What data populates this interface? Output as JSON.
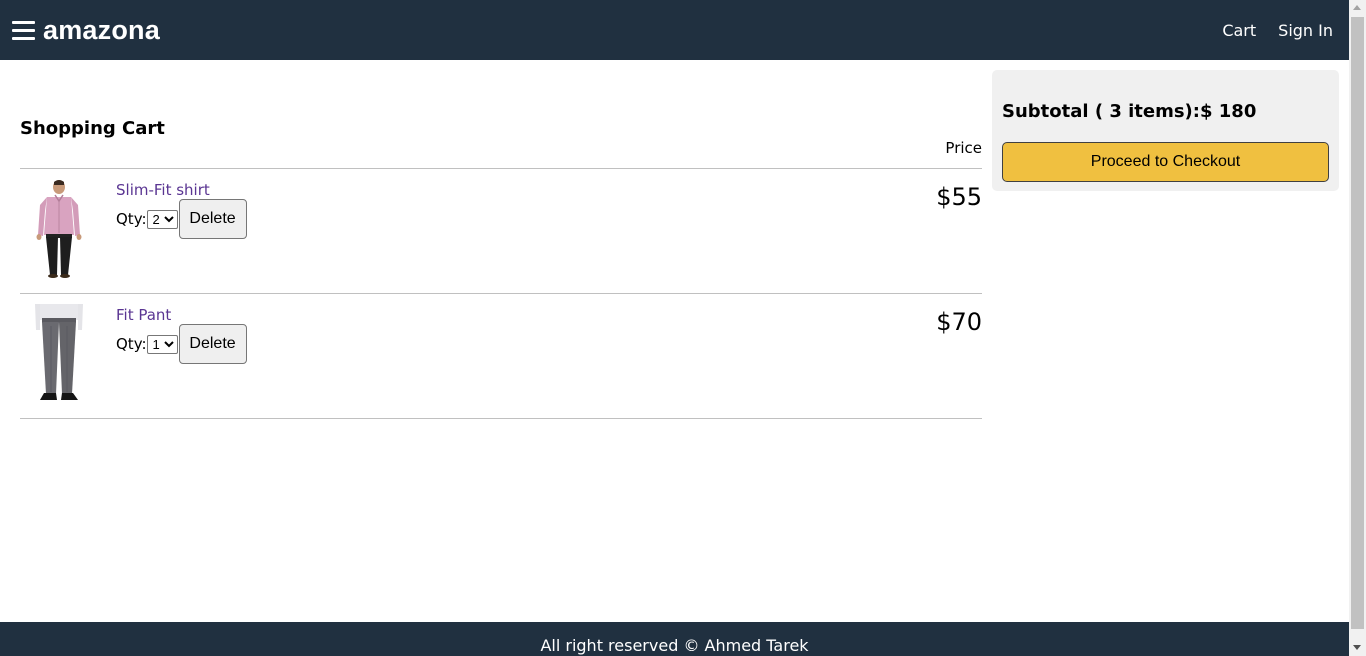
{
  "header": {
    "logo": "amazona",
    "nav": {
      "cart": "Cart",
      "sign_in": "Sign In"
    }
  },
  "cart": {
    "title": "Shopping Cart",
    "price_header": "Price",
    "qty_label": "Qty:",
    "delete_label": "Delete",
    "items": [
      {
        "name": "Slim-Fit shirt",
        "qty": "2",
        "price": "$55",
        "image": "shirt-image"
      },
      {
        "name": "Fit Pant",
        "qty": "1",
        "price": "$70",
        "image": "pant-image"
      }
    ]
  },
  "summary": {
    "subtotal": "Subtotal ( 3 items):$ 180",
    "checkout_label": "Proceed to Checkout"
  },
  "footer": {
    "text": "All right reserved © Ahmed Tarek"
  },
  "colors": {
    "header_bg": "#203040",
    "accent": "#f0c040",
    "link": "#5a3592",
    "summary_bg": "#f0f0f0"
  }
}
